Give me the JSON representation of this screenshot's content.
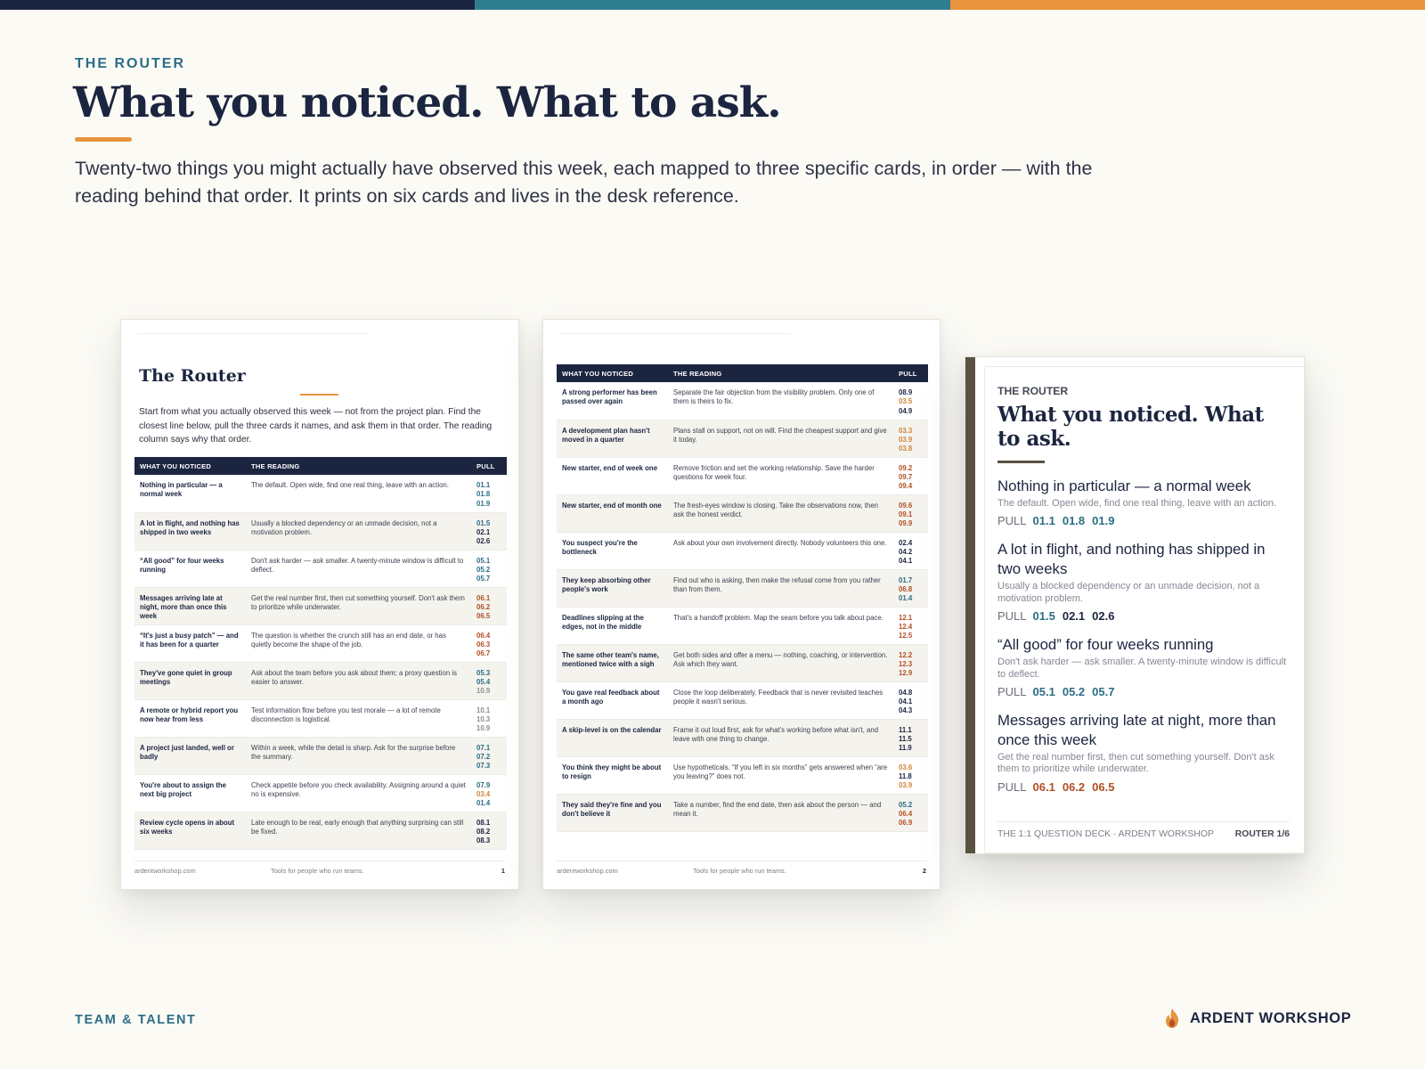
{
  "colors": {
    "navy": "#1c2540",
    "teal": "#2c6d86",
    "orange": "#e8943e",
    "rust": "#b24f25",
    "card_spine": "#595243",
    "background": "#fbfaf5"
  },
  "top_bar": [
    "#1c2540",
    "#2e7e90",
    "#e8943e"
  ],
  "header": {
    "eyebrow": "THE ROUTER",
    "title": "What you noticed. What to ask.",
    "intro": "Twenty-two things you might actually have observed this week, each mapped to three specific cards, in order — with the reading behind that order. It prints on six cards and lives in the desk reference."
  },
  "table_headers": {
    "noticed": "WHAT YOU NOTICED",
    "reading": "THE READING",
    "pull": "PULL"
  },
  "page1": {
    "title": "The Router",
    "intro": "Start from what you actually observed this week — not from the project plan. Find the closest line below, pull the three cards it names, and ask them in that order. The reading column says why that order.",
    "rows": [
      {
        "noticed": "Nothing in particular — a normal week",
        "reading": "The default. Open wide, find one real thing, leave with an action.",
        "pull": [
          {
            "code": "01.1",
            "tone": "teal"
          },
          {
            "code": "01.8",
            "tone": "teal"
          },
          {
            "code": "01.9",
            "tone": "teal"
          }
        ]
      },
      {
        "noticed": "A lot in flight, and nothing has shipped in two weeks",
        "reading": "Usually a blocked dependency or an unmade decision, not a motivation problem.",
        "pull": [
          {
            "code": "01.5",
            "tone": "teal"
          },
          {
            "code": "02.1",
            "tone": "navy"
          },
          {
            "code": "02.6",
            "tone": "navy"
          }
        ]
      },
      {
        "noticed": "“All good” for four weeks running",
        "reading": "Don't ask harder — ask smaller. A twenty-minute window is difficult to deflect.",
        "pull": [
          {
            "code": "05.1",
            "tone": "teal"
          },
          {
            "code": "05.2",
            "tone": "teal"
          },
          {
            "code": "05.7",
            "tone": "teal"
          }
        ]
      },
      {
        "noticed": "Messages arriving late at night, more than once this week",
        "reading": "Get the real number first, then cut something yourself. Don't ask them to prioritize while underwater.",
        "pull": [
          {
            "code": "06.1",
            "tone": "rust"
          },
          {
            "code": "06.2",
            "tone": "rust"
          },
          {
            "code": "06.5",
            "tone": "rust"
          }
        ]
      },
      {
        "noticed": "“It's just a busy patch” — and it has been for a quarter",
        "reading": "The question is whether the crunch still has an end date, or has quietly become the shape of the job.",
        "pull": [
          {
            "code": "06.4",
            "tone": "rust"
          },
          {
            "code": "06.3",
            "tone": "rust"
          },
          {
            "code": "06.7",
            "tone": "rust"
          }
        ]
      },
      {
        "noticed": "They've gone quiet in group meetings",
        "reading": "Ask about the team before you ask about them; a proxy question is easier to answer.",
        "pull": [
          {
            "code": "05.3",
            "tone": "teal"
          },
          {
            "code": "05.4",
            "tone": "teal"
          },
          {
            "code": "10.9",
            "tone": "grey"
          }
        ]
      },
      {
        "noticed": "A remote or hybrid report you now hear from less",
        "reading": "Test information flow before you test morale — a lot of remote disconnection is logistical.",
        "pull": [
          {
            "code": "10.1",
            "tone": "grey"
          },
          {
            "code": "10.3",
            "tone": "grey"
          },
          {
            "code": "10.9",
            "tone": "grey"
          }
        ]
      },
      {
        "noticed": "A project just landed, well or badly",
        "reading": "Within a week, while the detail is sharp. Ask for the surprise before the summary.",
        "pull": [
          {
            "code": "07.1",
            "tone": "teal"
          },
          {
            "code": "07.2",
            "tone": "teal"
          },
          {
            "code": "07.3",
            "tone": "teal"
          }
        ]
      },
      {
        "noticed": "You're about to assign the next big project",
        "reading": "Check appetite before you check availability. Assigning around a quiet no is expensive.",
        "pull": [
          {
            "code": "07.9",
            "tone": "teal"
          },
          {
            "code": "03.4",
            "tone": "orange"
          },
          {
            "code": "01.4",
            "tone": "teal"
          }
        ]
      },
      {
        "noticed": "Review cycle opens in about six weeks",
        "reading": "Late enough to be real, early enough that anything surprising can still be fixed.",
        "pull": [
          {
            "code": "08.1",
            "tone": "navy"
          },
          {
            "code": "08.2",
            "tone": "navy"
          },
          {
            "code": "08.3",
            "tone": "navy"
          }
        ]
      }
    ],
    "footer": {
      "site": "ardentworkshop.com",
      "tagline": "Tools for people who run teams.",
      "page": "1"
    }
  },
  "page2": {
    "rows": [
      {
        "noticed": "A strong performer has been passed over again",
        "reading": "Separate the fair objection from the visibility problem. Only one of them is theirs to fix.",
        "pull": [
          {
            "code": "08.9",
            "tone": "navy"
          },
          {
            "code": "03.5",
            "tone": "orange"
          },
          {
            "code": "04.9",
            "tone": "navy"
          }
        ]
      },
      {
        "noticed": "A development plan hasn't moved in a quarter",
        "reading": "Plans stall on support, not on will. Find the cheapest support and give it today.",
        "pull": [
          {
            "code": "03.3",
            "tone": "orange"
          },
          {
            "code": "03.9",
            "tone": "orange"
          },
          {
            "code": "03.8",
            "tone": "orange"
          }
        ]
      },
      {
        "noticed": "New starter, end of week one",
        "reading": "Remove friction and set the working relationship. Save the harder questions for week four.",
        "pull": [
          {
            "code": "09.2",
            "tone": "rust"
          },
          {
            "code": "09.7",
            "tone": "rust"
          },
          {
            "code": "09.4",
            "tone": "rust"
          }
        ]
      },
      {
        "noticed": "New starter, end of month one",
        "reading": "The fresh-eyes window is closing. Take the observations now, then ask the honest verdict.",
        "pull": [
          {
            "code": "09.6",
            "tone": "rust"
          },
          {
            "code": "09.1",
            "tone": "rust"
          },
          {
            "code": "09.9",
            "tone": "rust"
          }
        ]
      },
      {
        "noticed": "You suspect you're the bottleneck",
        "reading": "Ask about your own involvement directly. Nobody volunteers this one.",
        "pull": [
          {
            "code": "02.4",
            "tone": "navy"
          },
          {
            "code": "04.2",
            "tone": "navy"
          },
          {
            "code": "04.1",
            "tone": "navy"
          }
        ]
      },
      {
        "noticed": "They keep absorbing other people's work",
        "reading": "Find out who is asking, then make the refusal come from you rather than from them.",
        "pull": [
          {
            "code": "01.7",
            "tone": "teal"
          },
          {
            "code": "06.8",
            "tone": "rust"
          },
          {
            "code": "01.4",
            "tone": "teal"
          }
        ]
      },
      {
        "noticed": "Deadlines slipping at the edges, not in the middle",
        "reading": "That's a handoff problem. Map the seam before you talk about pace.",
        "pull": [
          {
            "code": "12.1",
            "tone": "rust"
          },
          {
            "code": "12.4",
            "tone": "rust"
          },
          {
            "code": "12.5",
            "tone": "rust"
          }
        ]
      },
      {
        "noticed": "The same other team's name, mentioned twice with a sigh",
        "reading": "Get both sides and offer a menu — nothing, coaching, or intervention. Ask which they want.",
        "pull": [
          {
            "code": "12.2",
            "tone": "rust"
          },
          {
            "code": "12.3",
            "tone": "rust"
          },
          {
            "code": "12.9",
            "tone": "rust"
          }
        ]
      },
      {
        "noticed": "You gave real feedback about a month ago",
        "reading": "Close the loop deliberately. Feedback that is never revisited teaches people it wasn't serious.",
        "pull": [
          {
            "code": "04.8",
            "tone": "navy"
          },
          {
            "code": "04.1",
            "tone": "navy"
          },
          {
            "code": "04.3",
            "tone": "navy"
          }
        ]
      },
      {
        "noticed": "A skip-level is on the calendar",
        "reading": "Frame it out loud first, ask for what's working before what isn't, and leave with one thing to change.",
        "pull": [
          {
            "code": "11.1",
            "tone": "navy"
          },
          {
            "code": "11.5",
            "tone": "navy"
          },
          {
            "code": "11.9",
            "tone": "navy"
          }
        ]
      },
      {
        "noticed": "You think they might be about to resign",
        "reading": "Use hypotheticals. “If you left in six months” gets answered when “are you leaving?” does not.",
        "pull": [
          {
            "code": "03.6",
            "tone": "orange"
          },
          {
            "code": "11.8",
            "tone": "navy"
          },
          {
            "code": "03.9",
            "tone": "orange"
          }
        ]
      },
      {
        "noticed": "They said they're fine and you don't believe it",
        "reading": "Take a number, find the end date, then ask about the person — and mean it.",
        "pull": [
          {
            "code": "05.2",
            "tone": "teal"
          },
          {
            "code": "06.4",
            "tone": "rust"
          },
          {
            "code": "06.9",
            "tone": "rust"
          }
        ]
      }
    ],
    "footer": {
      "site": "ardentworkshop.com",
      "tagline": "Tools for people who run teams.",
      "page": "2"
    }
  },
  "card": {
    "label": "THE ROUTER",
    "title": "What you noticed. What to ask.",
    "pull_label": "PULL",
    "entries": [
      {
        "q": "Nothing in particular — a normal week",
        "r": "The default. Open wide, find one real thing, leave with an action.",
        "pull": [
          {
            "code": "01.1",
            "tone": "teal"
          },
          {
            "code": "01.8",
            "tone": "teal"
          },
          {
            "code": "01.9",
            "tone": "teal"
          }
        ]
      },
      {
        "q": "A lot in flight, and nothing has shipped in two weeks",
        "r": "Usually a blocked dependency or an unmade decision, not a motivation problem.",
        "pull": [
          {
            "code": "01.5",
            "tone": "teal"
          },
          {
            "code": "02.1",
            "tone": "navy"
          },
          {
            "code": "02.6",
            "tone": "navy"
          }
        ]
      },
      {
        "q": "“All good” for four weeks running",
        "r": "Don't ask harder — ask smaller. A twenty-minute window is difficult to deflect.",
        "pull": [
          {
            "code": "05.1",
            "tone": "teal"
          },
          {
            "code": "05.2",
            "tone": "teal"
          },
          {
            "code": "05.7",
            "tone": "teal"
          }
        ]
      },
      {
        "q": "Messages arriving late at night, more than once this week",
        "r": "Get the real number first, then cut something yourself. Don't ask them to prioritize while underwater.",
        "pull": [
          {
            "code": "06.1",
            "tone": "rust"
          },
          {
            "code": "06.2",
            "tone": "rust"
          },
          {
            "code": "06.5",
            "tone": "rust"
          }
        ]
      }
    ],
    "footer_left": "THE 1:1 QUESTION DECK · ARDENT WORKSHOP",
    "footer_right": "ROUTER 1/6"
  },
  "footer": {
    "category": "TEAM & TALENT",
    "brand": "ARDENT WORKSHOP",
    "brand_icon": "flame-icon"
  }
}
